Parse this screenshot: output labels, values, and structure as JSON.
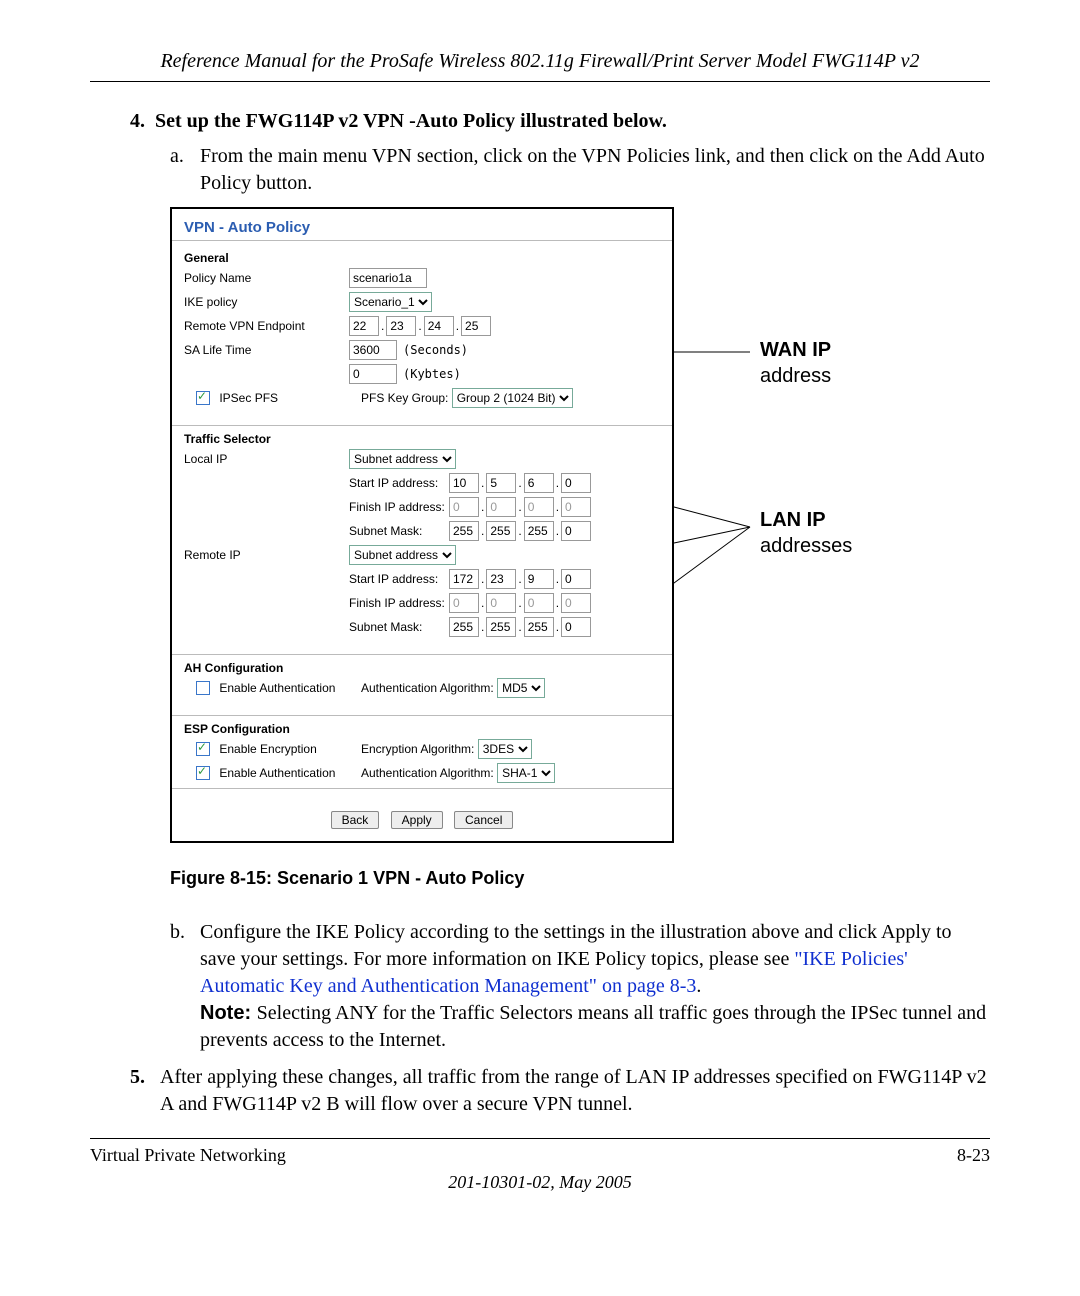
{
  "header": "Reference Manual for the ProSafe Wireless 802.11g  Firewall/Print Server Model FWG114P v2",
  "steps": {
    "num4": "4.",
    "heading4": "Set up the FWG114P v2 VPN -Auto Policy illustrated below.",
    "item_a_marker": "a.",
    "item_a_text": "From the main menu VPN section, click on the VPN Policies link, and then click on the Add Auto Policy button.",
    "item_b_marker": "b.",
    "item_b_text1": "Configure the IKE Policy according to the settings in the illustration above and click Apply to save your settings. For more information on IKE Policy topics, please see ",
    "item_b_link": "\"IKE Policies' Automatic Key and Authentication Management\" on page 8-3",
    "item_b_text2": ".",
    "item_b_note_label": "Note: ",
    "item_b_note_text": "Selecting ANY for the Traffic Selectors means all traffic goes through the IPSec tunnel and prevents access to the Internet.",
    "num5": "5.",
    "item5_text": "After applying these changes, all traffic from the range of LAN IP addresses specified on FWG114P v2 A and FWG114P v2 B will flow over a secure VPN tunnel."
  },
  "caption": "Figure 8-15:  Scenario 1 VPN - Auto Policy",
  "annotation": {
    "wan_line1": "WAN IP",
    "wan_line2": "address",
    "lan_line1": "LAN IP",
    "lan_line2": "addresses"
  },
  "footer": {
    "left": "Virtual Private Networking",
    "right": "8-23",
    "docid": "201-10301-02, May 2005"
  },
  "form": {
    "title": "VPN - Auto Policy",
    "general": {
      "heading": "General",
      "policy_name_label": "Policy Name",
      "policy_name_value": "scenario1a",
      "ike_policy_label": "IKE policy",
      "ike_policy_value": "Scenario_1",
      "remote_ep_label": "Remote VPN Endpoint",
      "remote_ep": [
        "22",
        "23",
        "24",
        "25"
      ],
      "sa_life_label": "SA Life Time",
      "sa_seconds_value": "3600",
      "sa_seconds_unit": "(Seconds)",
      "sa_kbytes_value": "0",
      "sa_kbytes_unit": "(Kybtes)",
      "ipsec_pfs_label": "IPSec PFS",
      "pfs_key_group_label": "PFS Key Group:",
      "pfs_key_group_value": "Group 2 (1024 Bit)"
    },
    "traffic": {
      "heading": "Traffic Selector",
      "local_ip_label": "Local IP",
      "subnet_value": "Subnet address",
      "start_ip_label": "Start IP address:",
      "finish_ip_label": "Finish IP address:",
      "subnet_mask_label": "Subnet Mask:",
      "local_start": [
        "10",
        "5",
        "6",
        "0"
      ],
      "local_finish": [
        "0",
        "0",
        "0",
        "0"
      ],
      "local_mask": [
        "255",
        "255",
        "255",
        "0"
      ],
      "remote_ip_label": "Remote IP",
      "remote_start": [
        "172",
        "23",
        "9",
        "0"
      ],
      "remote_finish": [
        "0",
        "0",
        "0",
        "0"
      ],
      "remote_mask": [
        "255",
        "255",
        "255",
        "0"
      ]
    },
    "ah": {
      "heading": "AH Configuration",
      "enable_auth_label": "Enable Authentication",
      "auth_algo_label": "Authentication Algorithm:",
      "auth_algo_value": "MD5"
    },
    "esp": {
      "heading": "ESP Configuration",
      "enable_enc_label": "Enable Encryption",
      "enc_algo_label": "Encryption Algorithm:",
      "enc_algo_value": "3DES",
      "enable_auth_label": "Enable Authentication",
      "auth_algo_label": "Authentication Algorithm:",
      "auth_algo_value": "SHA-1"
    },
    "buttons": {
      "back": "Back",
      "apply": "Apply",
      "cancel": "Cancel"
    }
  }
}
